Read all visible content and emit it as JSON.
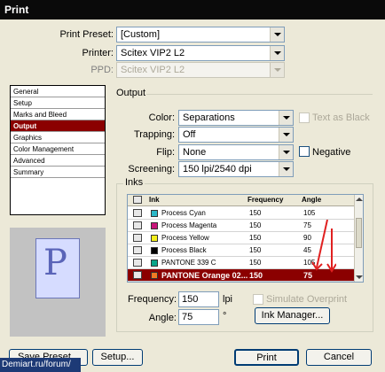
{
  "window": {
    "title": "Print"
  },
  "form": {
    "print_preset_label": "Print Preset:",
    "print_preset_value": "[Custom]",
    "printer_label": "Printer:",
    "printer_value": "Scitex VIP2 L2",
    "ppd_label": "PPD:",
    "ppd_value": "Scitex VIP2 L2"
  },
  "sidebar": {
    "items": [
      {
        "label": "General"
      },
      {
        "label": "Setup"
      },
      {
        "label": "Marks and Bleed"
      },
      {
        "label": "Output",
        "active": true
      },
      {
        "label": "Graphics"
      },
      {
        "label": "Color Management"
      },
      {
        "label": "Advanced"
      },
      {
        "label": "Summary"
      }
    ]
  },
  "preview": {
    "letter": "P"
  },
  "output": {
    "section_title": "Output",
    "color_label": "Color:",
    "color_value": "Separations",
    "text_as_black_label": "Text as Black",
    "trapping_label": "Trapping:",
    "trapping_value": "Off",
    "flip_label": "Flip:",
    "flip_value": "None",
    "negative_label": "Negative",
    "screening_label": "Screening:",
    "screening_value": "150 lpi/2540 dpi"
  },
  "inks": {
    "group_title": "Inks",
    "headers": {
      "ink": "Ink",
      "frequency": "Frequency",
      "angle": "Angle"
    },
    "rows": [
      {
        "name": "Process Cyan",
        "color": "#2bb8c8",
        "frequency": "150",
        "angle": "105"
      },
      {
        "name": "Process Magenta",
        "color": "#c8157a",
        "frequency": "150",
        "angle": "75"
      },
      {
        "name": "Process Yellow",
        "color": "#f2ee1a",
        "frequency": "150",
        "angle": "90"
      },
      {
        "name": "Process Black",
        "color": "#000000",
        "frequency": "150",
        "angle": "45"
      },
      {
        "name": "PANTONE 339 C",
        "color": "#0aa58a",
        "frequency": "150",
        "angle": "105"
      },
      {
        "name": "PANTONE Orange 02...",
        "color": "#f07a24",
        "frequency": "150",
        "angle": "75",
        "selected": true
      }
    ],
    "frequency_label": "Frequency:",
    "frequency_value": "150",
    "frequency_unit": "lpi",
    "angle_label": "Angle:",
    "angle_value": "75",
    "angle_unit": "°",
    "simulate_overprint_label": "Simulate Overprint",
    "ink_manager_label": "Ink Manager..."
  },
  "buttons": {
    "save_preset": "Save Preset...",
    "setup": "Setup...",
    "print": "Print",
    "cancel": "Cancel"
  },
  "watermark": "Demiart.ru/forum/",
  "colors": {
    "accent": "#8b0000",
    "annotation_arrow": "#e02020",
    "titlebar": "#0a0a0a"
  }
}
